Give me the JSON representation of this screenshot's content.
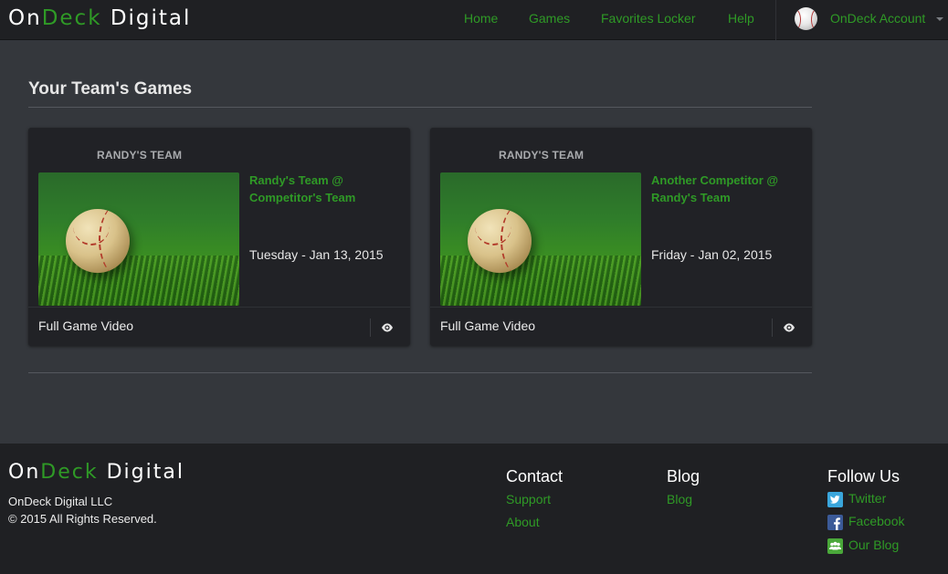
{
  "brand": {
    "part1": "On",
    "part2": "Deck",
    "part3": "Digital"
  },
  "nav": {
    "home": "Home",
    "games": "Games",
    "favorites": "Favorites Locker",
    "help": "Help",
    "account": "OnDeck Account"
  },
  "main": {
    "title": "Your Team's Games",
    "cards": [
      {
        "team": "RANDY'S TEAM",
        "matchup": "Randy's Team @ Competitor's Team",
        "date": "Tuesday - Jan 13, 2015",
        "video": "Full Game Video"
      },
      {
        "team": "RANDY'S TEAM",
        "matchup": "Another Competitor @ Randy's Team",
        "date": "Friday - Jan 02, 2015",
        "video": "Full Game Video"
      }
    ]
  },
  "footer": {
    "company": "OnDeck Digital LLC",
    "rights": "© 2015 All Rights Reserved.",
    "contact": {
      "title": "Contact",
      "support": "Support",
      "about": "About"
    },
    "blog": {
      "title": "Blog",
      "link": "Blog"
    },
    "follow": {
      "title": "Follow Us",
      "twitter": "Twitter",
      "facebook": "Facebook",
      "our_blog": "Our Blog"
    }
  },
  "colors": {
    "accent": "#2f9a26",
    "navbar": "#1f2023",
    "page": "#34373c",
    "card": "#212226"
  },
  "icons": {
    "avatar": "baseball-icon",
    "caret": "caret-down-icon",
    "view": "eye-icon",
    "twitter": "twitter-icon",
    "facebook": "facebook-icon",
    "blog": "community-icon"
  }
}
